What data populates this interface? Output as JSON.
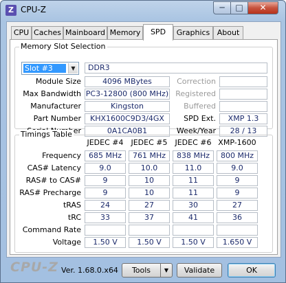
{
  "window": {
    "title": "CPU-Z",
    "icon_letter": "Z"
  },
  "title_buttons": {
    "minimize": "─",
    "maximize": "□",
    "close": "✕"
  },
  "tabs": [
    "CPU",
    "Caches",
    "Mainboard",
    "Memory",
    "SPD",
    "Graphics",
    "About"
  ],
  "active_tab": "SPD",
  "memory_slot": {
    "title": "Memory Slot Selection",
    "slot": "Slot #3",
    "type": "DDR3",
    "labels": {
      "module_size": "Module Size",
      "max_bandwidth": "Max Bandwidth",
      "manufacturer": "Manufacturer",
      "part_number": "Part Number",
      "serial_number": "Serial Number",
      "correction": "Correction",
      "registered": "Registered",
      "buffered": "Buffered",
      "spd_ext": "SPD Ext.",
      "week_year": "Week/Year"
    },
    "values": {
      "module_size": "4096 MBytes",
      "max_bandwidth": "PC3-12800 (800 MHz)",
      "manufacturer": "Kingston",
      "part_number": "KHX1600C9D3/4GX",
      "serial_number": "0A1CA0B1",
      "correction": "",
      "registered": "",
      "buffered": "",
      "spd_ext": "XMP 1.3",
      "week_year": "28 / 13"
    }
  },
  "timings": {
    "title": "Timings Table",
    "columns": [
      "JEDEC #4",
      "JEDEC #5",
      "JEDEC #6",
      "XMP-1600"
    ],
    "rows": [
      {
        "label": "Frequency",
        "values": [
          "685 MHz",
          "761 MHz",
          "838 MHz",
          "800 MHz"
        ]
      },
      {
        "label": "CAS# Latency",
        "values": [
          "9.0",
          "10.0",
          "11.0",
          "9.0"
        ]
      },
      {
        "label": "RAS# to CAS#",
        "values": [
          "9",
          "10",
          "11",
          "9"
        ]
      },
      {
        "label": "RAS# Precharge",
        "values": [
          "9",
          "10",
          "11",
          "9"
        ]
      },
      {
        "label": "tRAS",
        "values": [
          "24",
          "27",
          "30",
          "27"
        ]
      },
      {
        "label": "tRC",
        "values": [
          "33",
          "37",
          "41",
          "36"
        ]
      },
      {
        "label": "Command Rate",
        "values": [
          "",
          "",
          "",
          ""
        ]
      },
      {
        "label": "Voltage",
        "values": [
          "1.50 V",
          "1.50 V",
          "1.50 V",
          "1.650 V"
        ]
      }
    ]
  },
  "footer": {
    "logo": "CPU-Z",
    "version": "Ver. 1.68.0.x64",
    "tools": "Tools",
    "validate": "Validate",
    "ok": "OK"
  },
  "colors": {
    "value_text": "#1b2a6b",
    "selection": "#3399ff"
  }
}
